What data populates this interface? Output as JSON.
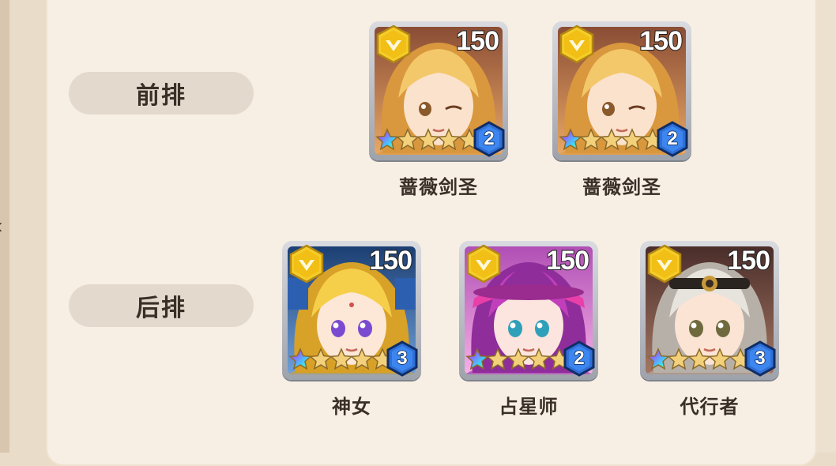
{
  "rows": {
    "front": {
      "label": "前排"
    },
    "back": {
      "label": "后排"
    }
  },
  "heroes": [
    {
      "name": "蔷薇剑圣",
      "level": "150",
      "rank": "2",
      "stars": 4
    },
    {
      "name": "蔷薇剑圣",
      "level": "150",
      "rank": "2",
      "stars": 4
    },
    {
      "name": "神女",
      "level": "150",
      "rank": "3",
      "stars": 4
    },
    {
      "name": "占星师",
      "level": "150",
      "rank": "2",
      "stars": 4
    },
    {
      "name": "代行者",
      "level": "150",
      "rank": "3",
      "stars": 4
    }
  ],
  "colors": {
    "badge_gold": "#e8b51d",
    "gem_blue": "#2f6fd6",
    "panel": "#f7efe4",
    "label_pill": "#e4d9cd"
  },
  "icons": {
    "badge": "gold-rank-badge-icon",
    "star": "gold-star-icon",
    "rainbow_star": "rainbow-star-icon",
    "gem": "blue-gem-icon"
  }
}
